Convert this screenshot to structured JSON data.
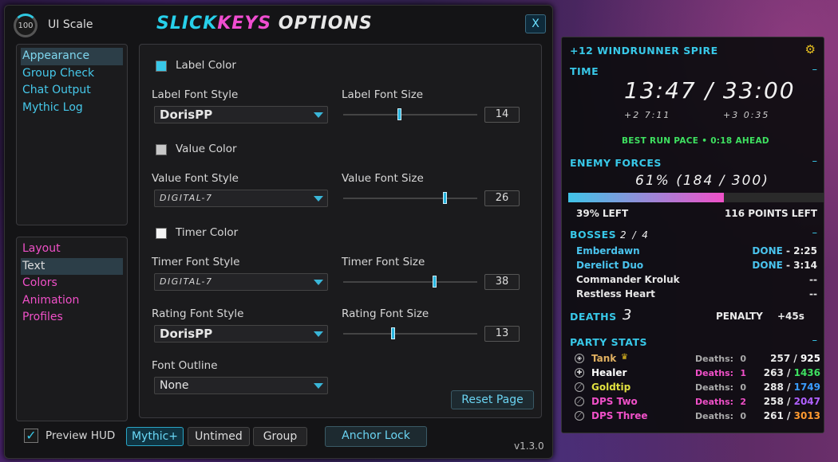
{
  "ui_scale": {
    "value": "100",
    "label": "UI Scale"
  },
  "window": {
    "title_a": "SLICK",
    "title_b": "KEYS",
    "title_c": " OPTIONS",
    "close_label": "X",
    "version": "v1.3.0"
  },
  "nav_top": [
    "Appearance",
    "Group Check",
    "Chat Output",
    "Mythic Log"
  ],
  "nav_bottom": [
    "Layout",
    "Text",
    "Colors",
    "Animation",
    "Profiles"
  ],
  "panel": {
    "label_color": "Label Color",
    "label_font_style": "Label Font Style",
    "label_font_value": "DorisPP",
    "label_font_size": "Label Font Size",
    "label_font_size_value": "14",
    "value_color": "Value Color",
    "value_font_style": "Value Font Style",
    "value_font_value": "DIGITAL-7",
    "value_font_size": "Value Font Size",
    "value_font_size_value": "26",
    "timer_color": "Timer Color",
    "timer_font_style": "Timer Font Style",
    "timer_font_value": "DIGITAL-7",
    "timer_font_size": "Timer Font Size",
    "timer_font_size_value": "38",
    "rating_font_style": "Rating Font Style",
    "rating_font_value": "DorisPP",
    "rating_font_size": "Rating Font Size",
    "rating_font_size_value": "13",
    "font_outline": "Font Outline",
    "font_outline_value": "None",
    "reset": "Reset Page"
  },
  "footer": {
    "preview": "Preview HUD",
    "mythic": "Mythic+",
    "untimed": "Untimed",
    "group": "Group",
    "anchor": "Anchor Lock"
  },
  "hud": {
    "dungeon": "+12  WINDRUNNER SPIRE",
    "time_title": "TIME",
    "timer": "13:47 / 33:00",
    "plus2": "+2  7:11",
    "plus3": "+3  0:35",
    "pace_label": "BEST RUN PACE",
    "pace_dot": "•",
    "pace_value": "0:18 AHEAD",
    "forces_title": "ENEMY FORCES",
    "forces": "61%  (184 / 300)",
    "forces_fraction": 0.61,
    "left_pct": "39% LEFT",
    "left_points": "116 POINTS LEFT",
    "bosses_title": "BOSSES",
    "bosses_count": "2 / 4",
    "bosses": [
      {
        "name": "Emberdawn",
        "status": "DONE",
        "time": " - 2:25"
      },
      {
        "name": "Derelict Duo",
        "status": "DONE",
        "time": " - 3:14"
      },
      {
        "name": "Commander Kroluk",
        "status": "--",
        "time": ""
      },
      {
        "name": "Restless Heart",
        "status": "--",
        "time": ""
      }
    ],
    "deaths_title": "DEATHS",
    "deaths": "3",
    "penalty_label": "PENALTY",
    "penalty": "+45s",
    "party_title": "PARTY STATS",
    "dash": "–",
    "party": [
      {
        "name": "Tank",
        "deaths_label": "Deaths:",
        "deaths": "0",
        "cur": "257",
        "sep": " / ",
        "max": "925",
        "color": "#e0b060",
        "maxcolor": "#ffffff"
      },
      {
        "name": "Healer",
        "deaths_label": "Deaths:",
        "deaths": "1",
        "cur": "263",
        "sep": " / ",
        "max": "1436",
        "color": "#ffffff",
        "maxcolor": "#3ee060"
      },
      {
        "name": "Goldtip",
        "deaths_label": "Deaths:",
        "deaths": "0",
        "cur": "288",
        "sep": " / ",
        "max": "1749",
        "color": "#e0e040",
        "maxcolor": "#3a9cff"
      },
      {
        "name": "DPS Two",
        "deaths_label": "Deaths:",
        "deaths": "2",
        "cur": "258",
        "sep": " / ",
        "max": "2047",
        "color": "#f050c8",
        "maxcolor": "#b060ff"
      },
      {
        "name": "DPS Three",
        "deaths_label": "Deaths:",
        "deaths": "0",
        "cur": "261",
        "sep": " / ",
        "max": "3013",
        "color": "#f050c8",
        "maxcolor": "#ff9a30"
      }
    ]
  }
}
